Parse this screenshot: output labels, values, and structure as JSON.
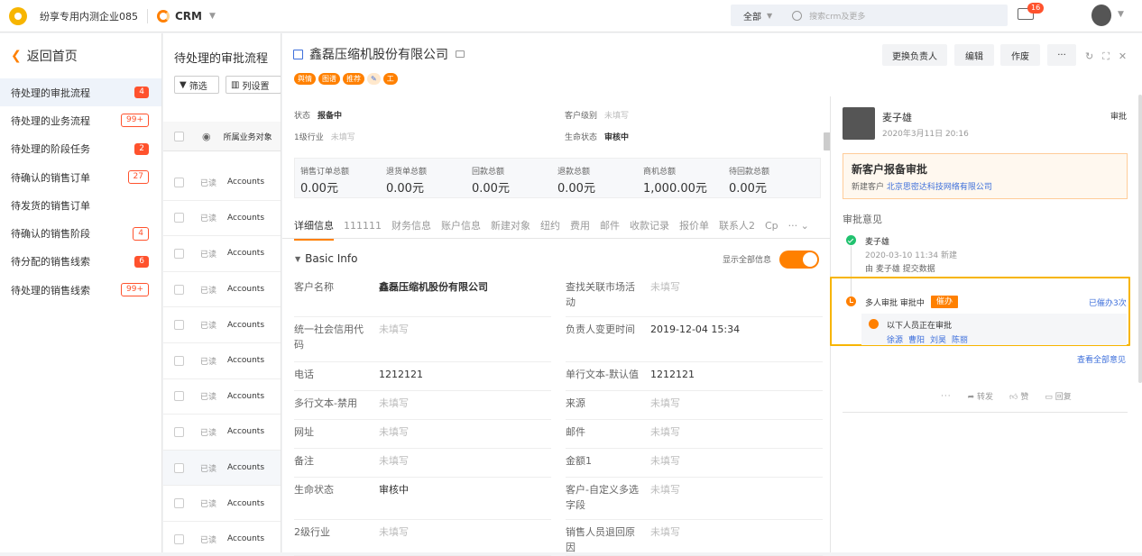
{
  "topbar": {
    "company": "纷享专用内测企业085",
    "app": "CRM",
    "search_scope": "全部",
    "search_placeholder": "搜索crm及更多",
    "mail_badge": "16"
  },
  "leftnav": {
    "back": "返回首页",
    "items": [
      {
        "label": "待处理的审批流程",
        "badge": "4",
        "badge_style": "solid"
      },
      {
        "label": "待处理的业务流程",
        "badge": "99+",
        "badge_style": "outline"
      },
      {
        "label": "待处理的阶段任务",
        "badge": "2",
        "badge_style": "solid"
      },
      {
        "label": "待确认的销售订单",
        "badge": "27",
        "badge_style": "outline"
      },
      {
        "label": "待发货的销售订单",
        "badge": "",
        "badge_style": ""
      },
      {
        "label": "待确认的销售阶段",
        "badge": "4",
        "badge_style": "outline"
      },
      {
        "label": "待分配的销售线索",
        "badge": "6",
        "badge_style": "solid"
      },
      {
        "label": "待处理的销售线索",
        "badge": "99+",
        "badge_style": "outline"
      }
    ]
  },
  "list": {
    "title": "待处理的审批流程",
    "filter": "筛选",
    "columns_setting": "列设置",
    "col_header": "所属业务对象",
    "rows": [
      {
        "read": "已读",
        "object": "Accounts"
      },
      {
        "read": "已读",
        "object": "Accounts"
      },
      {
        "read": "已读",
        "object": "Accounts"
      },
      {
        "read": "已读",
        "object": "Accounts"
      },
      {
        "read": "已读",
        "object": "Accounts"
      },
      {
        "read": "已读",
        "object": "Accounts"
      },
      {
        "read": "已读",
        "object": "Accounts"
      },
      {
        "read": "已读",
        "object": "Accounts"
      },
      {
        "read": "已读",
        "object": "Accounts"
      },
      {
        "read": "已读",
        "object": "Accounts"
      },
      {
        "read": "已读",
        "object": "Accounts"
      }
    ]
  },
  "detail": {
    "title": "鑫磊压缩机股份有限公司",
    "tags": [
      "舆情",
      "图谱",
      "推荐",
      "✎",
      "工"
    ],
    "buttons": [
      "更换负责人",
      "编辑",
      "作废",
      "···"
    ],
    "status_label": "状态",
    "status_value": "报备中",
    "level_label": "客户级别",
    "level_value": "未填写",
    "industry_label": "1级行业",
    "industry_value": "未填写",
    "lifecycle_label": "生命状态",
    "lifecycle_value": "审核中",
    "summary": [
      {
        "label": "销售订单总额",
        "value": "0.00元"
      },
      {
        "label": "退货单总额",
        "value": "0.00元"
      },
      {
        "label": "回款总额",
        "value": "0.00元"
      },
      {
        "label": "退款总额",
        "value": "0.00元"
      },
      {
        "label": "商机总额",
        "value": "1,000.00元"
      },
      {
        "label": "待回款总额",
        "value": "0.00元"
      }
    ],
    "tabs": [
      "详细信息",
      "111111",
      "财务信息",
      "账户信息",
      "新建对象",
      "纽约",
      "费用",
      "邮件",
      "收款记录",
      "报价单",
      "联系人2",
      "Cp",
      "··· ⌄"
    ],
    "section": "Basic Info",
    "show_all": "显示全部信息",
    "fields_left": [
      {
        "label": "客户名称",
        "value": "鑫磊压缩机股份有限公司",
        "kind": "strong"
      },
      {
        "label": "统一社会信用代码",
        "value": "未填写",
        "kind": "na"
      },
      {
        "label": "电话",
        "value": "1212121",
        "kind": "normal"
      },
      {
        "label": "多行文本-禁用",
        "value": "未填写",
        "kind": "na"
      },
      {
        "label": "网址",
        "value": "未填写",
        "kind": "na"
      },
      {
        "label": "备注",
        "value": "未填写",
        "kind": "na"
      },
      {
        "label": "生命状态",
        "value": "审核中",
        "kind": "normal"
      },
      {
        "label": "2级行业",
        "value": "未填写",
        "kind": "na"
      }
    ],
    "fields_right": [
      {
        "label": "查找关联市场活动",
        "value": "未填写",
        "kind": "na"
      },
      {
        "label": "负责人变更时间",
        "value": "2019-12-04 15:34",
        "kind": "normal"
      },
      {
        "label": "单行文本-默认值",
        "value": "1212121",
        "kind": "normal"
      },
      {
        "label": "来源",
        "value": "未填写",
        "kind": "na"
      },
      {
        "label": "邮件",
        "value": "未填写",
        "kind": "na"
      },
      {
        "label": "金额1",
        "value": "未填写",
        "kind": "na"
      },
      {
        "label": "客户-自定义多选字段",
        "value": "未填写",
        "kind": "na"
      },
      {
        "label": "销售人员退回原因",
        "value": "未填写",
        "kind": "na"
      }
    ]
  },
  "approval": {
    "name": "麦子雄",
    "time": "2020年3月11日 20:16",
    "type": "审批",
    "card_title": "新客户报备审批",
    "card_prefix": "新建客户",
    "card_link": "北京思密达科技网络有限公司",
    "opinion_title": "审批意见",
    "step1_name": "麦子雄",
    "step1_time": "2020-03-10 11:34 新建",
    "step1_desc": "由 麦子雄 提交数据",
    "step2_title": "多人审批 审批中",
    "urge": "催办",
    "urged_count": "已催办3次",
    "pending_text": "以下人员正在审批",
    "approvers": [
      "徐源",
      "曹阳",
      "刘昊",
      "陈丽"
    ],
    "view_all": "查看全部意见",
    "forward": "转发",
    "like": "赞",
    "reply": "回复"
  }
}
